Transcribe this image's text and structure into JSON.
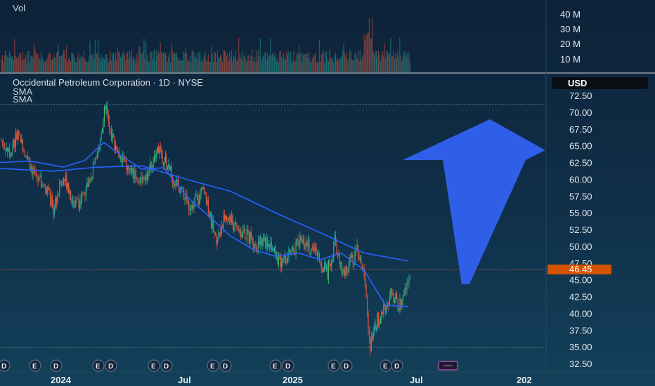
{
  "header": {
    "title": "Occidental Petroleum Corporation · 1D · NYSE",
    "indicators": [
      "SMA",
      "SMA"
    ]
  },
  "volume_panel": {
    "label": "Vol",
    "ticks": [
      "40 M",
      "30 M",
      "20 M",
      "10 M"
    ]
  },
  "price_axis": {
    "currency": "USD",
    "ticks": [
      "72.50",
      "70.00",
      "67.50",
      "65.00",
      "62.50",
      "60.00",
      "57.50",
      "55.00",
      "52.50",
      "50.00",
      "47.50",
      "45.00",
      "42.50",
      "40.00",
      "37.50",
      "35.00",
      "32.50"
    ],
    "last_price": "46.45",
    "last_price_color": "#d35400"
  },
  "time_axis": {
    "labels": [
      "2024",
      "Jul",
      "2025",
      "Jul",
      "202"
    ]
  },
  "events": {
    "earnings_marker": "E",
    "dividend_marker": "D"
  },
  "colors": {
    "up": "#26a69a",
    "up_bright": "#3dbb6a",
    "down": "#e0563a",
    "sma_short": "#2962ff",
    "sma_long": "#2962ff",
    "arrow": "#2f5fe8",
    "background": "#0e2436"
  },
  "chart_data": {
    "type": "candlestick",
    "title": "Occidental Petroleum Corporation · 1D · NYSE",
    "ylim": [
      31,
      75
    ],
    "series": [
      {
        "name": "SMA",
        "type": "line",
        "anchors": [
          [
            "2023-11-20",
            62.5
          ],
          [
            "2024-01-01",
            62.7
          ],
          [
            "2024-02-15",
            61.8
          ],
          [
            "2024-03-15",
            62.8
          ],
          [
            "2024-04-10",
            65.5
          ],
          [
            "2024-05-01",
            63.8
          ],
          [
            "2024-06-01",
            61.5
          ],
          [
            "2024-07-01",
            61.7
          ],
          [
            "2024-08-01",
            57.5
          ],
          [
            "2024-09-01",
            54.5
          ],
          [
            "2024-10-01",
            51.5
          ],
          [
            "2024-11-01",
            49.5
          ],
          [
            "2024-12-01",
            48.5
          ],
          [
            "2025-01-01",
            49.0
          ],
          [
            "2025-02-01",
            48.0
          ],
          [
            "2025-03-01",
            49.0
          ],
          [
            "2025-04-01",
            46.5
          ],
          [
            "2025-05-01",
            41.2
          ],
          [
            "2025-06-01",
            41.0
          ]
        ]
      },
      {
        "name": "SMA",
        "type": "line",
        "anchors": [
          [
            "2023-11-20",
            61.6
          ],
          [
            "2024-02-01",
            61.2
          ],
          [
            "2024-04-01",
            61.8
          ],
          [
            "2024-06-01",
            62.0
          ],
          [
            "2024-08-01",
            60.0
          ],
          [
            "2024-10-01",
            58.2
          ],
          [
            "2024-12-01",
            55.0
          ],
          [
            "2025-02-01",
            52.0
          ],
          [
            "2025-04-01",
            49.0
          ],
          [
            "2025-06-01",
            47.8
          ]
        ]
      }
    ],
    "price_anchors": [
      [
        "2023-11-20",
        66
      ],
      [
        "2023-12-05",
        64
      ],
      [
        "2023-12-15",
        67
      ],
      [
        "2024-01-05",
        61
      ],
      [
        "2024-01-25",
        58
      ],
      [
        "2024-02-01",
        55.5
      ],
      [
        "2024-02-15",
        61
      ],
      [
        "2024-03-01",
        56
      ],
      [
        "2024-03-15",
        58
      ],
      [
        "2024-04-01",
        63
      ],
      [
        "2024-04-12",
        71.5
      ],
      [
        "2024-04-18",
        67
      ],
      [
        "2024-05-10",
        62
      ],
      [
        "2024-05-25",
        60
      ],
      [
        "2024-06-10",
        61
      ],
      [
        "2024-06-25",
        64.5
      ],
      [
        "2024-07-10",
        61
      ],
      [
        "2024-08-05",
        56
      ],
      [
        "2024-08-25",
        58
      ],
      [
        "2024-09-10",
        51
      ],
      [
        "2024-09-25",
        55
      ],
      [
        "2024-10-05",
        53
      ],
      [
        "2024-10-25",
        51.5
      ],
      [
        "2024-11-05",
        50
      ],
      [
        "2024-11-20",
        51
      ],
      [
        "2024-12-10",
        47
      ],
      [
        "2025-01-05",
        51
      ],
      [
        "2025-01-25",
        49
      ],
      [
        "2025-02-10",
        46
      ],
      [
        "2025-02-20",
        50.5
      ],
      [
        "2025-03-05",
        46
      ],
      [
        "2025-03-25",
        49.5
      ],
      [
        "2025-04-03",
        44
      ],
      [
        "2025-04-08",
        37
      ],
      [
        "2025-04-10",
        35
      ],
      [
        "2025-04-20",
        39
      ],
      [
        "2025-05-01",
        41
      ],
      [
        "2025-05-10",
        43
      ],
      [
        "2025-05-20",
        41
      ],
      [
        "2025-06-05",
        46.45
      ]
    ],
    "volume_ticks_millions": [
      40,
      30,
      20,
      10
    ],
    "last_price": 46.45
  }
}
